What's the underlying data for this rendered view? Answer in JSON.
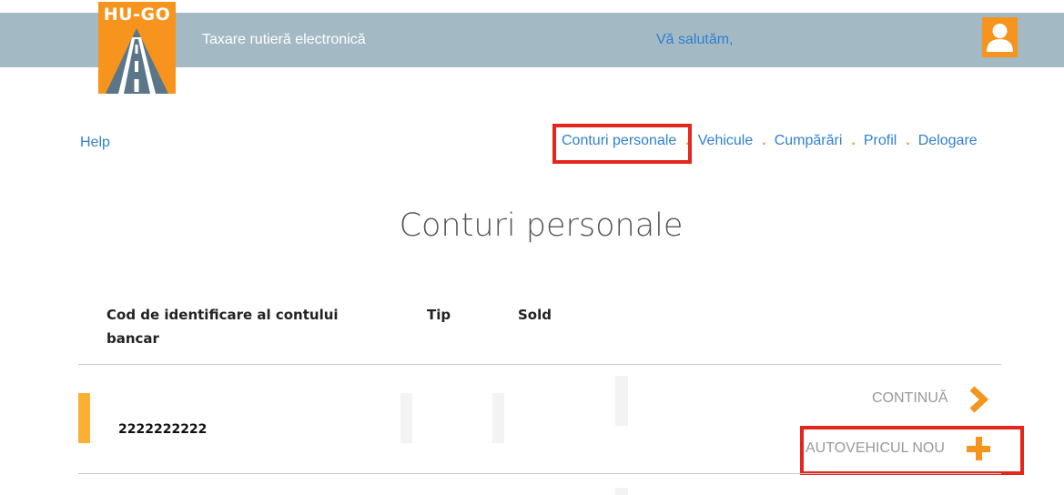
{
  "header": {
    "logo_text": "HU-GO",
    "app_title": "Taxare rutieră electronică",
    "greeting": "Vă salutăm,"
  },
  "nav": {
    "help": "Help",
    "items": [
      {
        "label": "Conturi personale",
        "active": true
      },
      {
        "label": "Vehicule"
      },
      {
        "label": "Cumpărări"
      },
      {
        "label": "Profil"
      },
      {
        "label": "Delogare"
      }
    ],
    "separator": "."
  },
  "page": {
    "title": "Conturi personale"
  },
  "table": {
    "columns": [
      "Cod de identificare al contului bancar",
      "Tip",
      "Sold"
    ],
    "rows": [
      {
        "code": "2222222222",
        "actions": {
          "continue": "CONTINUĂ",
          "new_vehicle": "AUTOVEHICUL NOU"
        }
      }
    ]
  },
  "colors": {
    "header_bar": "#a3bac5",
    "accent_orange": "#f7941d",
    "link_blue": "#2f7fd0",
    "highlight_red": "#e5261a"
  },
  "icons": {
    "logo": "road-icon",
    "avatar": "user-icon",
    "continue": "chevron-right-icon",
    "new_vehicle": "plus-icon"
  }
}
